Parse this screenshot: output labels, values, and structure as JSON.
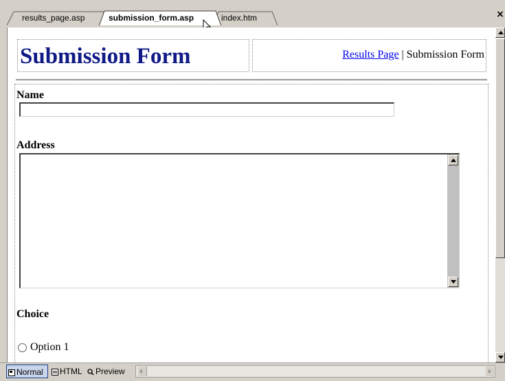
{
  "tabs": [
    {
      "label": "results_page.asp",
      "active": false
    },
    {
      "label": "submission_form.asp",
      "active": true
    },
    {
      "label": "index.htm",
      "active": false
    }
  ],
  "close_symbol": "×",
  "page": {
    "title": "Submission Form",
    "nav_link": "Results Page",
    "nav_separator": " | ",
    "nav_current": "Submission Form"
  },
  "form": {
    "name_label": "Name",
    "name_value": "",
    "address_label": "Address",
    "address_value": "",
    "choice_label": "Choice",
    "option1_label": "Option 1"
  },
  "view_buttons": {
    "normal": "Normal",
    "html": "HTML",
    "preview": "Preview"
  },
  "colors": {
    "title": "#0f1a86",
    "link": "#0000ee",
    "chrome": "#d4d0c8"
  }
}
